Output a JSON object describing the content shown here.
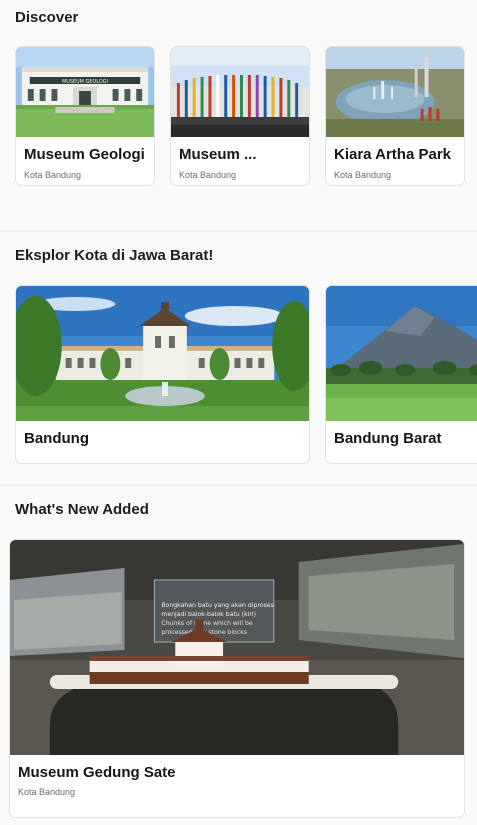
{
  "discover": {
    "title": "Discover",
    "items": [
      {
        "name": "Museum Geologi",
        "location": "Kota Bandung"
      },
      {
        "name": "Museum ...",
        "location": "Kota Bandung"
      },
      {
        "name": "Kiara Artha Park",
        "location": "Kota Bandung"
      }
    ]
  },
  "explore": {
    "title": "Eksplor Kota di Jawa Barat!",
    "items": [
      {
        "name": "Bandung"
      },
      {
        "name": "Bandung Barat"
      }
    ]
  },
  "whats_new": {
    "title": "What's New Added",
    "items": [
      {
        "name": "Museum Gedung Sate",
        "location": "Kota Bandung",
        "image_caption": [
          "Bongkahan batu yang akan diproses",
          "menjadi balok-balok batu (kiri)",
          "Chunks of stone which will be",
          "processed into stone blocks"
        ]
      }
    ]
  },
  "image_signage": {
    "museum_geologi": "MUSEUM GEOLOGI"
  },
  "colors": {
    "page_bg": "#efefef",
    "section_bg": "#f9f9f9",
    "card_bg": "#ffffff",
    "card_border": "#e2e2e2",
    "subtitle": "#6c6c6c"
  }
}
